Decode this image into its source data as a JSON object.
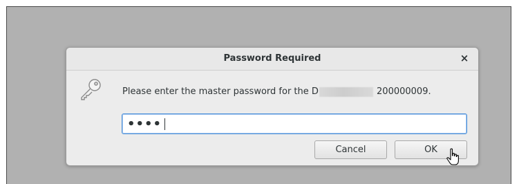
{
  "dialog": {
    "title": "Password Required",
    "close_glyph": "×",
    "message_part1": "Please enter the master password for the D",
    "message_part2": " 200000009.",
    "password_dots": "••••",
    "cancel_label": "Cancel",
    "ok_label": "OK",
    "icon": "key-icon"
  },
  "colors": {
    "backdrop": "#b1b1b1",
    "dialog_bg": "#ececec",
    "focus_border": "#4a90d9",
    "text": "#2e3436"
  }
}
